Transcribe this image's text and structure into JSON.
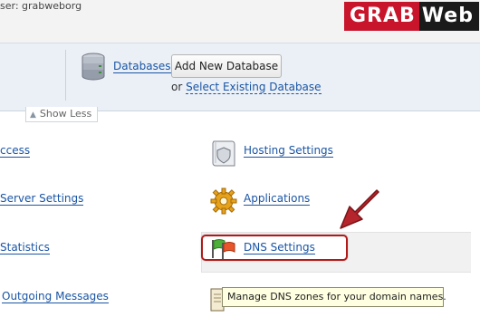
{
  "header": {
    "user_text": "ser: grabweborg",
    "logo_part1": "GRAB",
    "logo_part2": "Web"
  },
  "databases_panel": {
    "databases_link": "Databases",
    "add_button": "Add New Database",
    "or_text": "or",
    "select_existing_link": "Select Existing Database"
  },
  "toggle": {
    "label": "Show Less"
  },
  "left_column": [
    {
      "label": "ccess"
    },
    {
      "label": "Server Settings"
    },
    {
      "label": "Statistics"
    },
    {
      "label": "Outgoing Messages"
    }
  ],
  "right_column": [
    {
      "label": "Hosting Settings",
      "icon": "document-shield-icon"
    },
    {
      "label": "Applications",
      "icon": "gear-icon"
    },
    {
      "label": "DNS Settings",
      "icon": "flags-icon"
    }
  ],
  "tooltip": {
    "text": "Manage DNS zones for your domain names."
  },
  "colors": {
    "accent": "#c8152c",
    "link": "#1a55a5",
    "highlight_border": "#b21a1a"
  }
}
